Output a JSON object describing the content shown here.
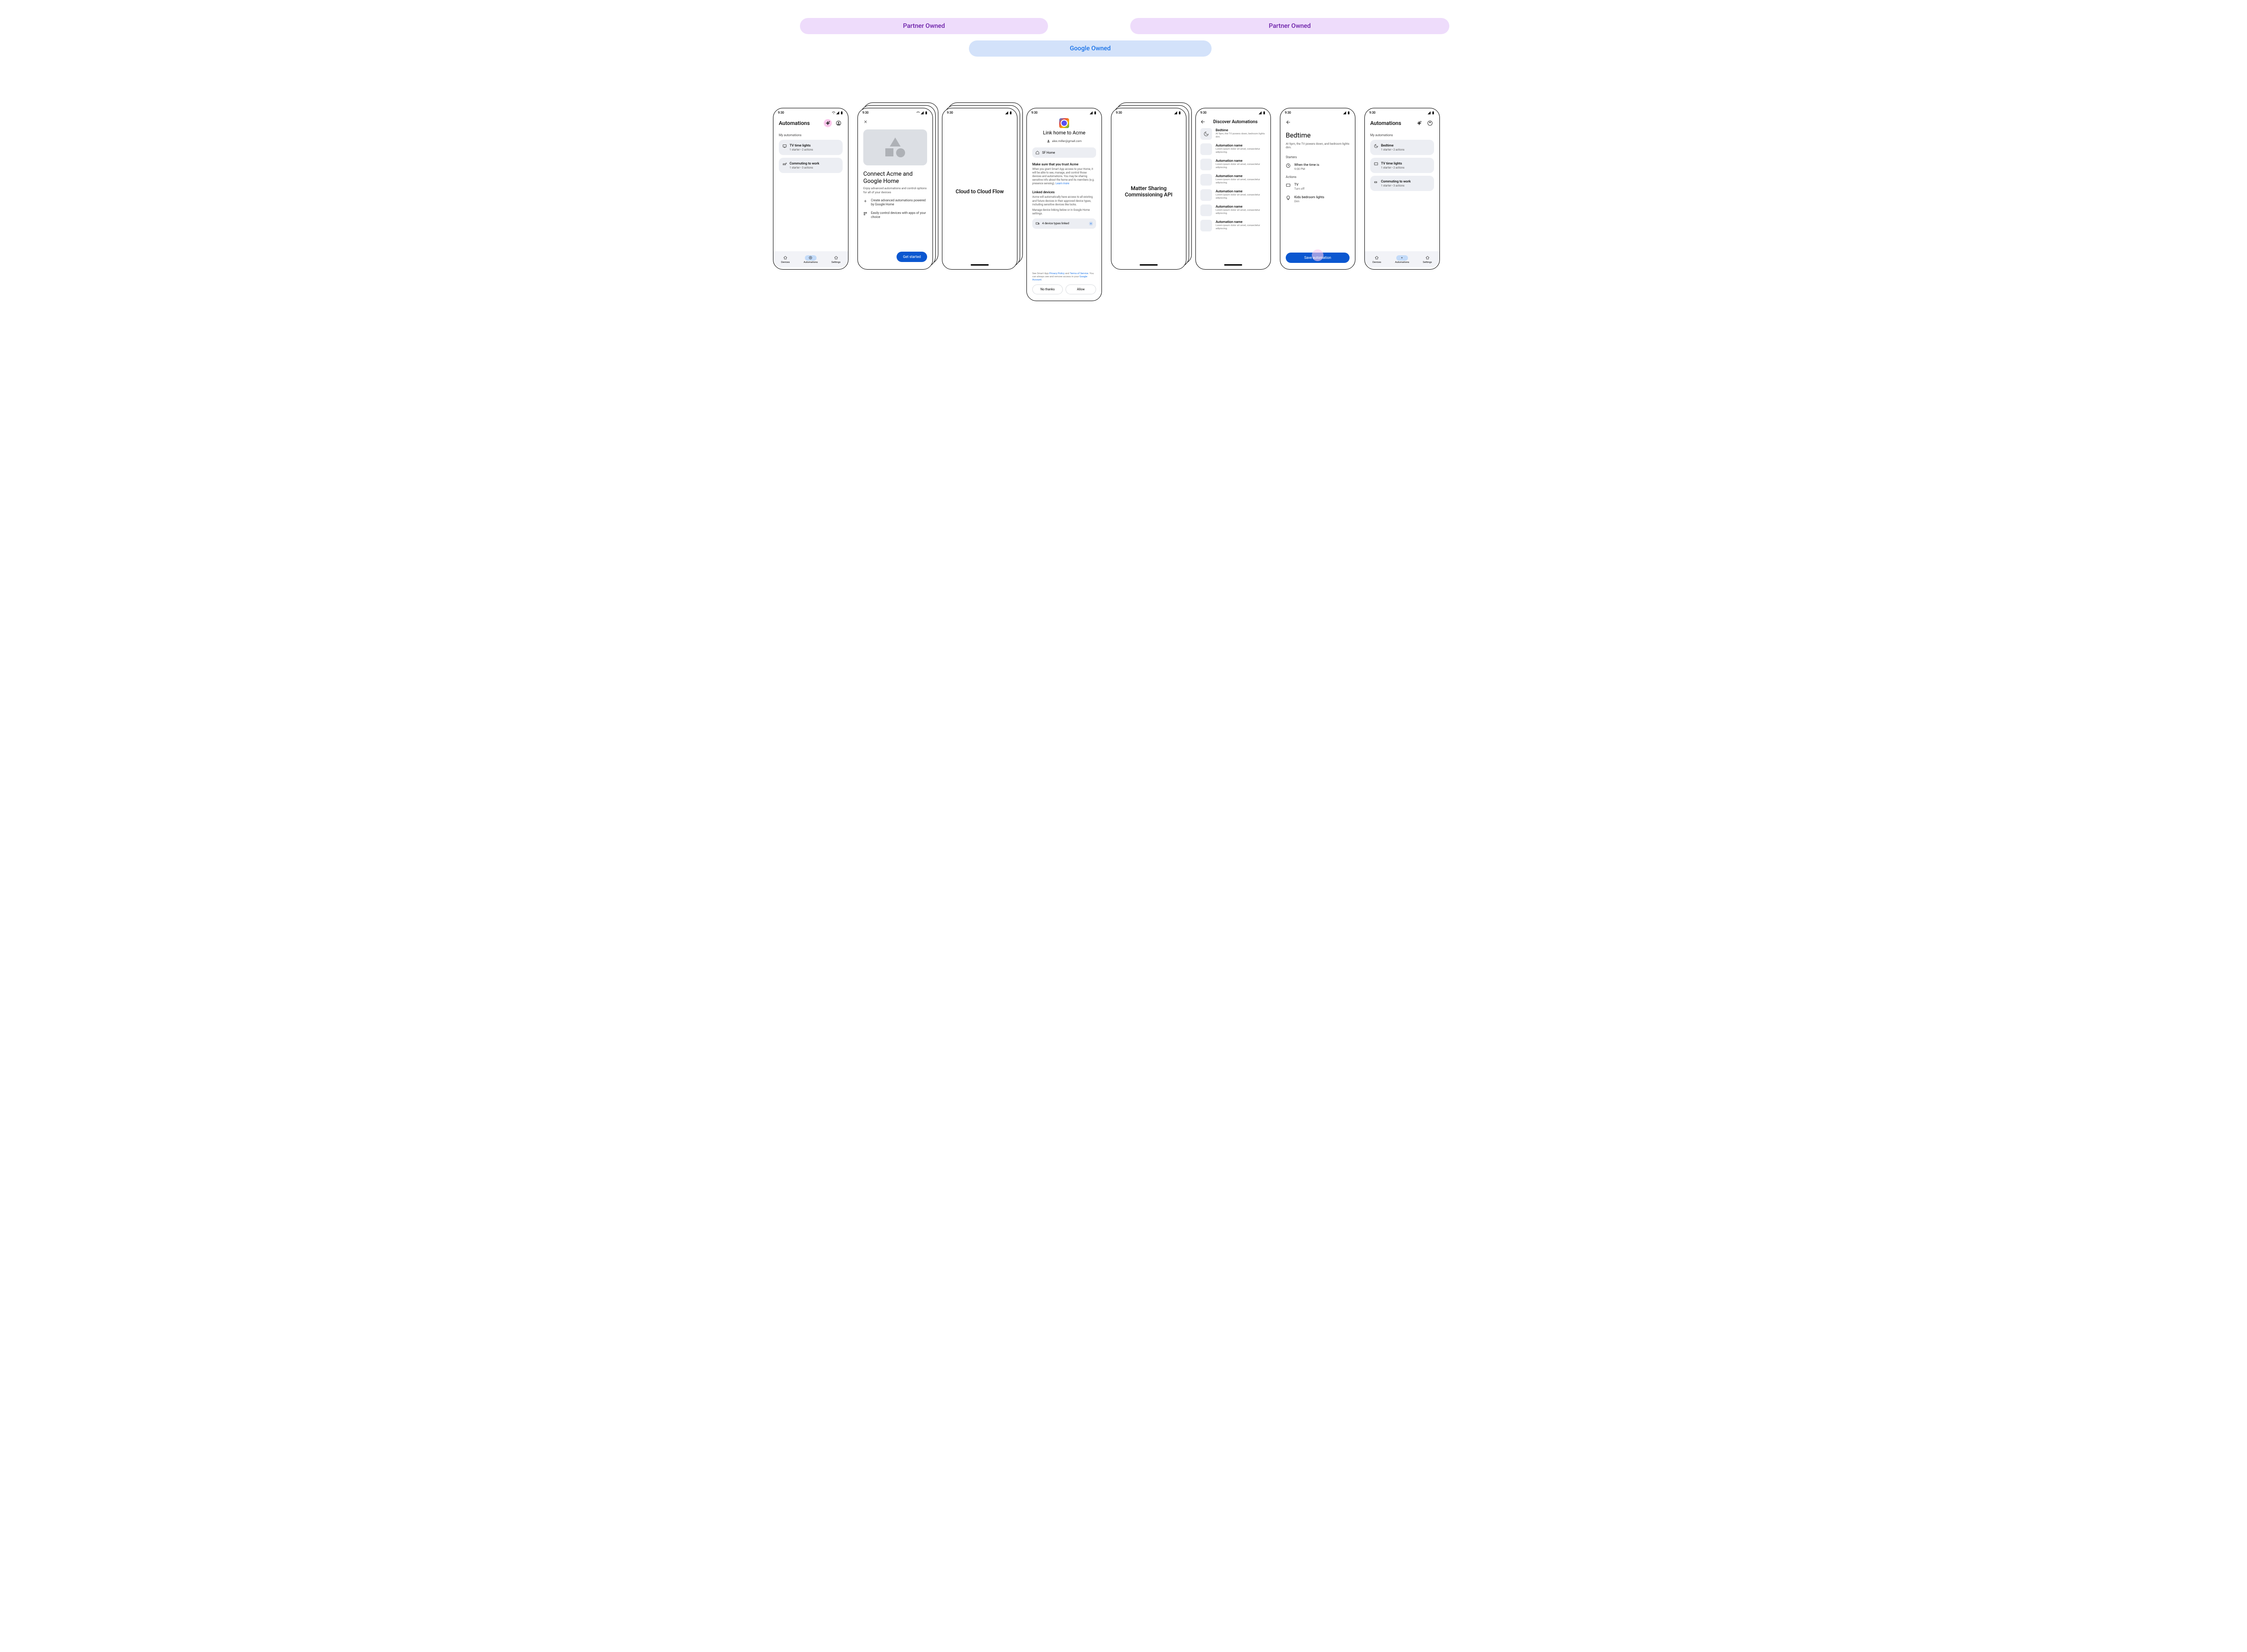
{
  "banners": {
    "partner1": "Partner Owned",
    "google": "Google Owned",
    "partner2": "Partner Owned"
  },
  "status": {
    "time": "9:30"
  },
  "nav": {
    "devices": "Devices",
    "automations": "Automations",
    "settings": "Settings"
  },
  "screen1": {
    "title": "Automations",
    "section": "My automations",
    "items": [
      {
        "title": "TV time lights",
        "sub": "1 starter • 2 actions"
      },
      {
        "title": "Commuting to work",
        "sub": "1 starter • 3 actions"
      }
    ]
  },
  "screen2": {
    "title": "Connect Acme and Google Home",
    "sub": "Enjoy advanced automations and control options for all of your devices",
    "f1": "Create advanced automations powered by Google Home",
    "f2": "Easily control devices with apps of your choice",
    "btn": "Get started"
  },
  "screen3": {
    "text": "Cloud to Cloud Flow"
  },
  "screen4": {
    "title": "Link home to Acme",
    "email": "alex.miller@gmail.com",
    "home": "SF Home",
    "trust_title": "Make sure that you trust Acme",
    "trust_body": "When you grant Smart App access to your Home, it will be able to  see, manage, and control those devices and automations. You may be sharing sensitive info about the home and its members (e.g. presence sensing). ",
    "trust_link": "Learn more",
    "linked_title": "Linked devices",
    "linked_body1": "Acme will automatically have access to all existing and future devices in their approved device types, including sensitive devices like locks.",
    "linked_body2": "Manage device linking below or in Google Home settings.",
    "device_chip": "4 device types linked",
    "footer1": "See Smart App ",
    "footer_pp": "Privacy Policy",
    "footer_and": " and ",
    "footer_tos": "Terms of Service",
    "footer2": ". You can always see and remove access in your ",
    "footer_ga": "Google Account",
    "footer_period": ".",
    "no": "No thanks",
    "allow": "Allow"
  },
  "screen5": {
    "text": "Matter Sharing Commissioning API"
  },
  "screen6": {
    "title": "Discover Automations",
    "featured": {
      "name": "Bedtime",
      "desc": "At 9pm, the TV powers down, bedroom lights dim."
    },
    "generic": {
      "name": "Automation name",
      "desc": "Lorem ipsum dolor sit amet, consectetur adipiscing."
    },
    "count": 6
  },
  "screen7": {
    "title": "Bedtime",
    "sub": "At 9pm, the TV powers down, and bedroom lights dim.",
    "starters": "Starters",
    "starter1": {
      "t": "When the time is",
      "s": "9:00 PM"
    },
    "actions": "Actions",
    "action1": {
      "t": "TV",
      "s": "Turn off"
    },
    "action2": {
      "t": "Kids bedroom lights",
      "s": "Dim"
    },
    "btn": "Save automation"
  },
  "screen8": {
    "title": "Automations",
    "section": "My automations",
    "items": [
      {
        "title": "Bedtime",
        "sub": "1 starter • 2 actions"
      },
      {
        "title": "TV time lights",
        "sub": "1 starter • 2 actions"
      },
      {
        "title": "Commuting to work",
        "sub": "1 starter • 3 actions"
      }
    ]
  }
}
